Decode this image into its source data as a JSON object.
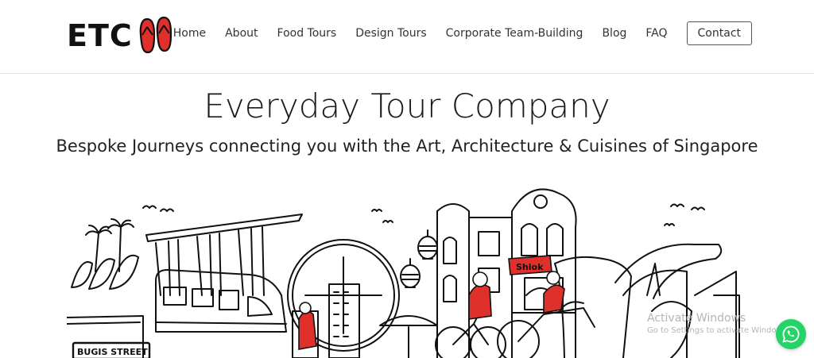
{
  "brand": {
    "logo_text": "ETC",
    "logo_icon": "flip-flops-icon",
    "accent_color": "#e0302b"
  },
  "nav": {
    "items": [
      "Home",
      "About",
      "Food Tours",
      "Design Tours",
      "Corporate Team-Building",
      "Blog",
      "FAQ"
    ],
    "contact_label": "Contact"
  },
  "hero": {
    "title": "Everyday Tour Company",
    "subtitle": "Bespoke Journeys connecting you with the Art, Architecture & Cuisines of Singapore"
  },
  "illustration": {
    "signs": {
      "street": "BUGIS STREET",
      "shiok": "Shiok"
    }
  },
  "watermark": {
    "line1": "Activate Windows",
    "line2": "Go to Settings to activate Windows."
  },
  "whatsapp": {
    "icon": "whatsapp-icon",
    "color": "#25d366"
  }
}
